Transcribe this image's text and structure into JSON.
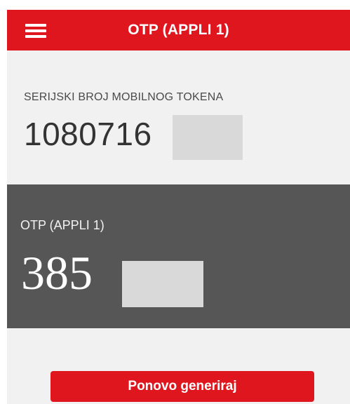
{
  "header": {
    "menu_icon": "hamburger-menu-icon",
    "title": "OTP (APPLI 1)",
    "background": "#e0161e"
  },
  "token": {
    "serial_label": "SERIJSKI BROJ MOBILNOG TOKENA",
    "serial_value": "1080716"
  },
  "otp": {
    "label": "OTP (APPLI 1)",
    "value": "385",
    "panel_background": "#565656"
  },
  "actions": {
    "regenerate_label": "Ponovo generiraj",
    "accent": "#e0161e"
  }
}
